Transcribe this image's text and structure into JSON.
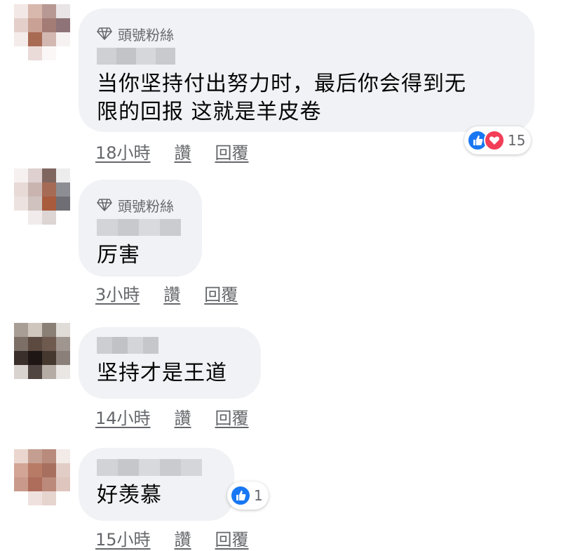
{
  "colors": {
    "bubble": "#f0f2f5",
    "meta_text": "#65676b",
    "like_blue": "#1877f2",
    "love_red": "#f33e58"
  },
  "comments": [
    {
      "badge": "頭號粉絲",
      "text": "当你坚持付出努力时，最后你会得到无\n限的回报 这就是羊皮卷",
      "time": "18小時",
      "like": "讚",
      "reply": "回覆",
      "reactions": {
        "icons": [
          "like-icon",
          "love-icon"
        ],
        "count": "15"
      }
    },
    {
      "badge": "頭號粉絲",
      "text": "厉害",
      "time": "3小時",
      "like": "讚",
      "reply": "回覆"
    },
    {
      "text": "坚持才是王道",
      "time": "14小時",
      "like": "讚",
      "reply": "回覆"
    },
    {
      "text": "好羡慕",
      "time": "15小時",
      "like": "讚",
      "reply": "回覆",
      "reactions": {
        "icons": [
          "like-icon"
        ],
        "count": "1"
      }
    }
  ]
}
